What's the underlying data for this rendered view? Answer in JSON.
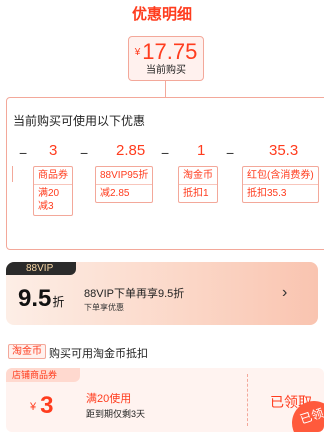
{
  "title": "优惠明细",
  "price": {
    "currency": "¥",
    "amount": "17.75",
    "label": "当前购买"
  },
  "detail": {
    "heading": "当前购买可使用以下优惠",
    "ops": [
      "−",
      "−",
      "−",
      "−"
    ],
    "values": [
      "3",
      "2.85",
      "1",
      "35.3"
    ],
    "coupons": [
      {
        "head": "商品券",
        "lines": [
          "满20",
          "减3"
        ]
      },
      {
        "head": "88VIP95折",
        "lines": [
          "减2.85"
        ]
      },
      {
        "head": "淘金币",
        "lines": [
          "抵扣1"
        ]
      },
      {
        "head": "红包(含消费券)",
        "lines": [
          "抵扣35.3"
        ]
      }
    ]
  },
  "vip": {
    "tag": "88VIP",
    "rate": "9.5",
    "rate_unit": "折",
    "main": "88VIP下单再享9.5折",
    "sub": "下单享优惠",
    "arrow": "›"
  },
  "taojinbi": {
    "tag": "淘金币",
    "text": "购买可用淘金币抵扣"
  },
  "store_coupon": {
    "tag": "店铺商品券",
    "currency": "¥",
    "amount": "3",
    "condition": "满20使用",
    "expire": "距到期仅剩3天",
    "status": "已领取",
    "stamp": "已领"
  },
  "colors": {
    "accent": "#ff3c1e",
    "border": "#f3a89a",
    "tint": "#fff1ee"
  }
}
